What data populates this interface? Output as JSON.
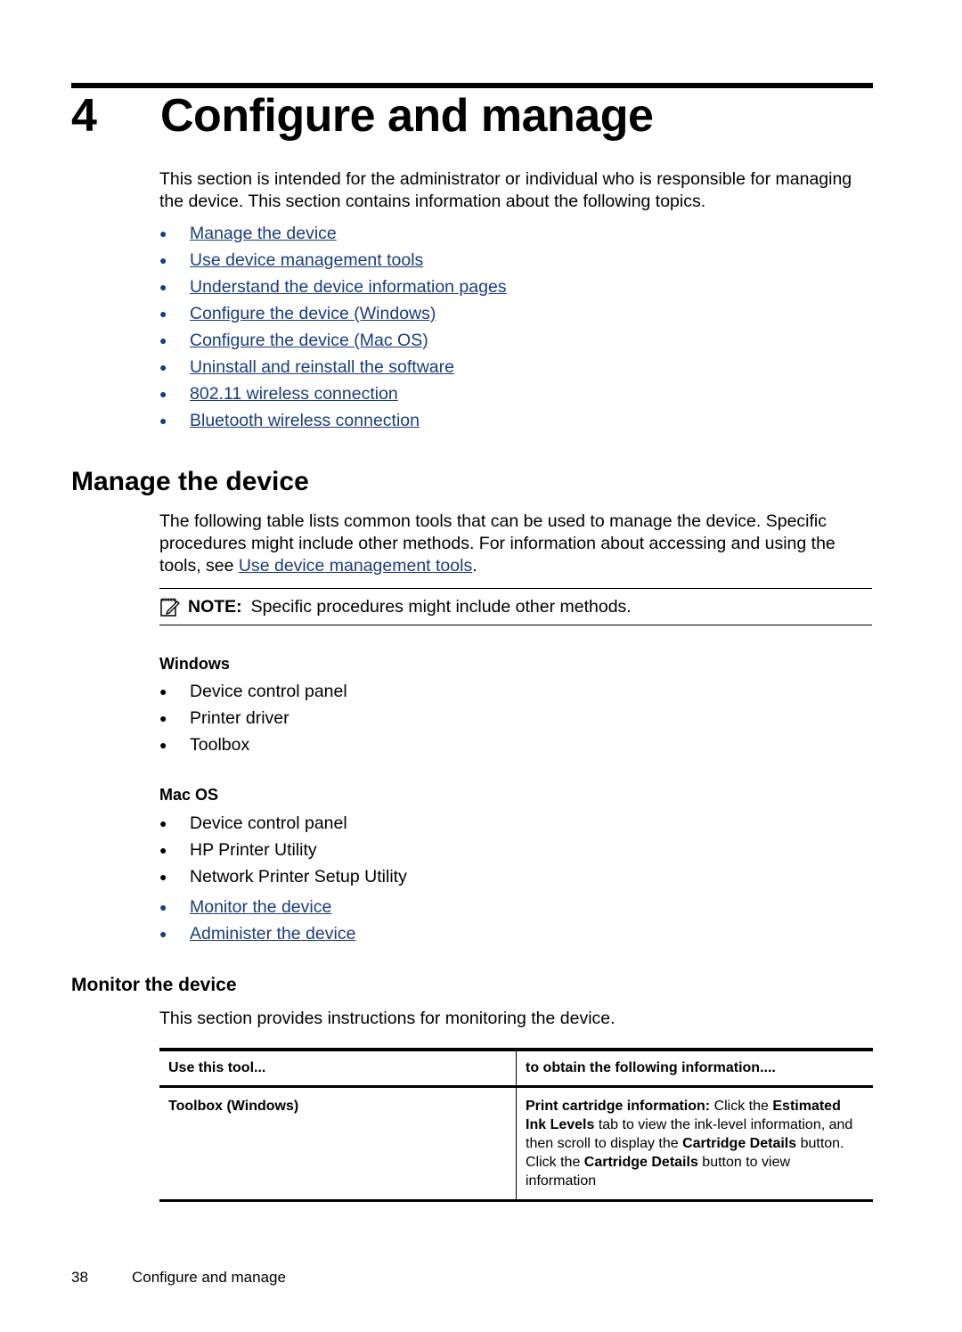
{
  "chapter": {
    "number": "4",
    "title": "Configure and manage"
  },
  "intro": "This section is intended for the administrator or individual who is responsible for managing the device. This section contains information about the following topics.",
  "topics": [
    "Manage the device",
    "Use device management tools",
    "Understand the device information pages",
    "Configure the device (Windows)",
    "Configure the device (Mac OS)",
    "Uninstall and reinstall the software",
    "802.11 wireless connection",
    "Bluetooth wireless connection"
  ],
  "manage": {
    "heading": "Manage the device",
    "para_before": "The following table lists common tools that can be used to manage the device. Specific procedures might include other methods. For information about accessing and using the tools, see ",
    "para_link": "Use device management tools",
    "para_after": ".",
    "note_label": "NOTE:",
    "note_text": "Specific procedures might include other methods.",
    "windows_heading": "Windows",
    "windows_items": [
      "Device control panel",
      "Printer driver",
      "Toolbox"
    ],
    "mac_heading": "Mac OS",
    "mac_items": [
      "Device control panel",
      "HP Printer Utility",
      "Network Printer Setup Utility"
    ],
    "sub_links": [
      "Monitor the device",
      "Administer the device"
    ]
  },
  "monitor": {
    "heading": "Monitor the device",
    "intro": "This section provides instructions for monitoring the device.",
    "table": {
      "headers": [
        "Use this tool...",
        "to obtain the following information...."
      ],
      "rows": [
        {
          "tool": "Toolbox (Windows)",
          "info_parts": [
            {
              "b": "Print cartridge information:"
            },
            {
              "t": " Click the "
            },
            {
              "b": "Estimated Ink Levels"
            },
            {
              "t": " tab to view the ink-level information, and then scroll to display the "
            },
            {
              "b": "Cartridge Details"
            },
            {
              "t": " button. Click the "
            },
            {
              "b": "Cartridge Details"
            },
            {
              "t": " button to view information"
            }
          ]
        }
      ]
    }
  },
  "footer": {
    "page_number": "38",
    "chapter_title": "Configure and manage"
  }
}
